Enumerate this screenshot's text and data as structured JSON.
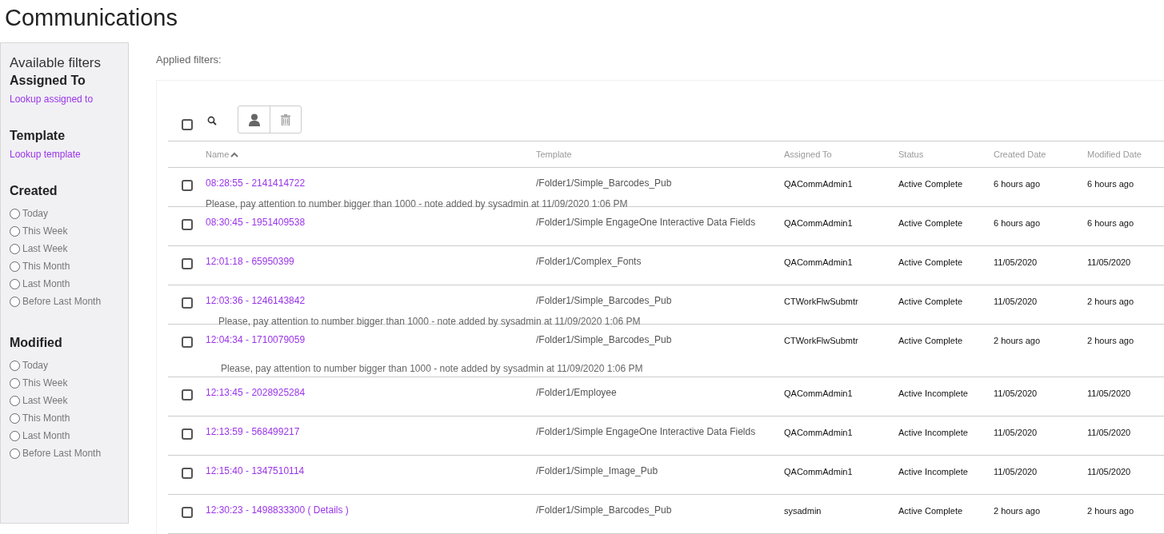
{
  "page_title": "Communications",
  "sidebar": {
    "title": "Available filters",
    "sections": [
      {
        "kind": "lookup",
        "heading": "Assigned To",
        "link": "Lookup assigned to"
      },
      {
        "kind": "lookup",
        "heading": "Template",
        "link": "Lookup template"
      },
      {
        "kind": "radios",
        "heading": "Created",
        "options": [
          {
            "label": "Today",
            "selected": false
          },
          {
            "label": "This Week",
            "selected": false
          },
          {
            "label": "Last Week",
            "selected": false
          },
          {
            "label": "This Month",
            "selected": false
          },
          {
            "label": "Last Month",
            "selected": false
          },
          {
            "label": "Before Last Month",
            "selected": false
          }
        ]
      },
      {
        "kind": "radios",
        "heading": "Modified",
        "options": [
          {
            "label": "Today",
            "selected": false
          },
          {
            "label": "This Week",
            "selected": false
          },
          {
            "label": "Last Week",
            "selected": false
          },
          {
            "label": "This Month",
            "selected": false
          },
          {
            "label": "Last Month",
            "selected": false
          },
          {
            "label": "Before Last Month",
            "selected": false
          }
        ]
      }
    ]
  },
  "applied_filters": "Applied filters:",
  "table": {
    "select_all": {
      "checked": false
    },
    "columns": [
      {
        "label": "Name",
        "sorted": true
      },
      {
        "label": "Template",
        "sorted": false
      },
      {
        "label": "Assigned To",
        "sorted": false
      },
      {
        "label": "Status",
        "sorted": false
      },
      {
        "label": "Created Date",
        "sorted": false
      },
      {
        "label": "Modified Date",
        "sorted": false
      }
    ],
    "rows": [
      {
        "checked": false,
        "name": "08:28:55 - 2141414722",
        "template": "/Folder1/Simple_Barcodes_Pub",
        "assigned_to": "QACommAdmin1",
        "status": "Active Complete",
        "created": "6 hours ago",
        "modified": "6 hours ago",
        "note": "Please, pay attention to number bigger than 1000 - note added by sysadmin at 11/09/2020 1:06 PM"
      },
      {
        "checked": false,
        "name": "08:30:45 - 1951409538",
        "template": "/Folder1/Simple EngageOne Interactive Data Fields",
        "assigned_to": "QACommAdmin1",
        "status": "Active Complete",
        "created": "6 hours ago",
        "modified": "6 hours ago"
      },
      {
        "checked": false,
        "name": "12:01:18 - 65950399",
        "template": "/Folder1/Complex_Fonts",
        "assigned_to": "QACommAdmin1",
        "status": "Active Complete",
        "created": "11/05/2020",
        "modified": "11/05/2020"
      },
      {
        "checked": false,
        "name": "12:03:36 - 1246143842",
        "template": "/Folder1/Simple_Barcodes_Pub",
        "assigned_to": "CTWorkFlwSubmtr",
        "status": "Active Complete",
        "created": "11/05/2020",
        "modified": "2 hours ago",
        "note": "Please, pay attention to number bigger than 1000 - note added by sysadmin at 11/09/2020 1:06 PM"
      },
      {
        "checked": false,
        "name": "12:04:34 - 1710079059",
        "template": "/Folder1/Simple_Barcodes_Pub",
        "assigned_to": "CTWorkFlwSubmtr",
        "status": "Active Complete",
        "created": "2 hours ago",
        "modified": "2 hours ago",
        "note": "Please, pay attention to number bigger than 1000 - note added by sysadmin at 11/09/2020 1:06 PM"
      },
      {
        "checked": false,
        "name": "12:13:45 - 2028925284",
        "template": "/Folder1/Employee",
        "assigned_to": "QACommAdmin1",
        "status": "Active Incomplete",
        "created": "11/05/2020",
        "modified": "11/05/2020"
      },
      {
        "checked": false,
        "name": "12:13:59 - 568499217",
        "template": "/Folder1/Simple EngageOne Interactive Data Fields",
        "assigned_to": "QACommAdmin1",
        "status": "Active Incomplete",
        "created": "11/05/2020",
        "modified": "11/05/2020"
      },
      {
        "checked": false,
        "name": "12:15:40 - 1347510114",
        "template": "/Folder1/Simple_Image_Pub",
        "assigned_to": "QACommAdmin1",
        "status": "Active Incomplete",
        "created": "11/05/2020",
        "modified": "11/05/2020"
      },
      {
        "checked": false,
        "name": "12:30:23 - 1498833300 ( Details )",
        "template": "/Folder1/Simple_Barcodes_Pub",
        "assigned_to": "sysadmin",
        "status": "Active Complete",
        "created": "2 hours ago",
        "modified": "2 hours ago"
      }
    ]
  }
}
